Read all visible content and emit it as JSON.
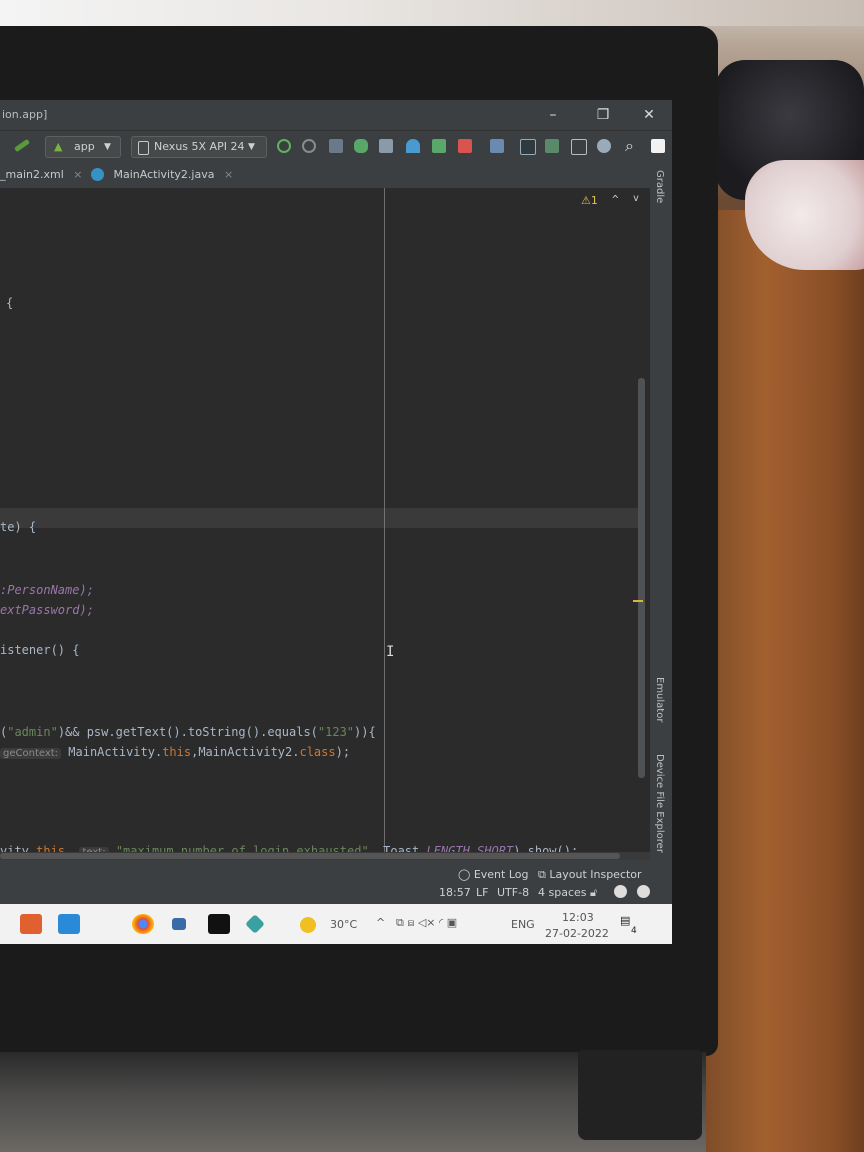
{
  "window": {
    "title": "ion.app]",
    "minimize": "–",
    "restore": "❐",
    "close": "✕"
  },
  "toolbar": {
    "run_config": "app",
    "device": "Nexus 5X API 24"
  },
  "tabs": [
    {
      "label": "_main2.xml",
      "close": "×"
    },
    {
      "label": "MainActivity2.java",
      "close": "×"
    }
  ],
  "editor": {
    "warnings": "⚠1",
    "line_brace": "{",
    "line_oncreate": "te) {",
    "line_personname": ":PersonName);",
    "line_password": "extPassword);",
    "line_listener": "istener() {",
    "line_admin_pre": "(",
    "line_admin_str": "\"admin\"",
    "line_admin_mid": ")&& psw.getText().toString().equals(",
    "line_admin_str2": "\"123\"",
    "line_admin_end": ")){",
    "line_intent_hint": "geContext:",
    "line_intent_pre": " MainActivity.",
    "line_intent_this": "this",
    "line_intent_mid": ",MainActivity2.",
    "line_intent_class": "class",
    "line_intent_end": ");",
    "line_toast_pre": "vity.",
    "line_toast_this": "this",
    "line_toast_comma": ", ",
    "line_toast_hint": "text:",
    "line_toast_str": " \"maximum number of login exhausted\"",
    "line_toast_mid": ", Toast.",
    "line_toast_field": "LENGTH_SHORT",
    "line_toast_end": ").show();"
  },
  "side_panels": {
    "gradle": "Gradle",
    "emulator": "Emulator",
    "device_file_explorer": "Device File Explorer"
  },
  "bottom_bar": {
    "event_log": "Event Log",
    "layout_inspector": "Layout Inspector",
    "position": "18:57",
    "line_ending": "LF",
    "encoding": "UTF-8",
    "indent": "4 spaces"
  },
  "taskbar": {
    "temperature": "30°C",
    "language": "ENG",
    "time": "12:03",
    "date": "27-02-2022",
    "notifications": "4"
  },
  "colors": {
    "ide_bg": "#2b2b2b",
    "toolbar_bg": "#3c3f41",
    "keyword": "#cc7832",
    "string": "#6a8759",
    "field": "#9876aa",
    "text": "#a9b7c6"
  }
}
